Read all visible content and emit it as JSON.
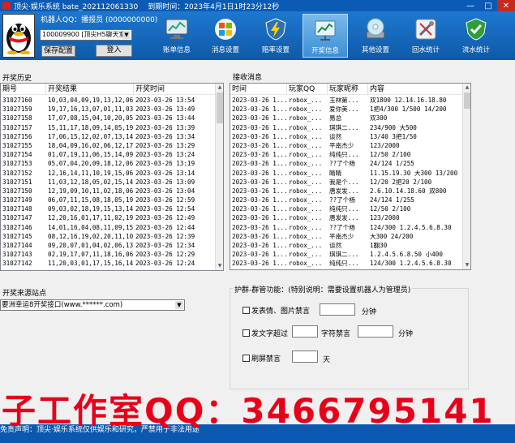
{
  "window": {
    "title": "顶尖·娱乐系统 bate_202112061330",
    "expire": "到期时间：2023年4月1日1时23分12秒",
    "min": "—",
    "max": "□",
    "close": "✕"
  },
  "header": {
    "robot_qq": "机器人QQ：播报员 (0000000000)",
    "robot_selected": "100009900 [顶尖H5聊天室]",
    "save_label": "保存配置",
    "login_label": "登入",
    "tabs": [
      {
        "label": "账单信息",
        "icon": "monitor-chart-icon"
      },
      {
        "label": "消息设置",
        "icon": "windows-logo-icon"
      },
      {
        "label": "赔率设置",
        "icon": "lightning-shield-icon"
      },
      {
        "label": "开奖信息",
        "icon": "screen-chart-icon"
      },
      {
        "label": "其他设置",
        "icon": "disc-drive-icon"
      },
      {
        "label": "回水统计",
        "icon": "tools-icon"
      },
      {
        "label": "流水统计",
        "icon": "green-shield-icon"
      }
    ]
  },
  "history": {
    "title": "开奖历史",
    "columns": [
      "期号",
      "开奖结果",
      "开奖时间"
    ],
    "rows": [
      [
        "31027160",
        "10,03,04,09,19,13,12,06",
        "2023-03-26 13:54"
      ],
      [
        "31027159",
        "19,17,16,13,07,01,11,03",
        "2023-03-26 13:49"
      ],
      [
        "31027158",
        "17,07,08,15,04,10,20,05",
        "2023-03-26 13:44"
      ],
      [
        "31027157",
        "15,11,17,18,09,14,05,19",
        "2023-03-26 13:39"
      ],
      [
        "31027156",
        "17,06,15,12,02,07,13,14",
        "2023-03-26 13:34"
      ],
      [
        "31027155",
        "18,04,09,16,02,06,12,17",
        "2023-03-26 13:29"
      ],
      [
        "31027154",
        "01,07,19,11,06,15,14,09",
        "2023-03-26 13:24"
      ],
      [
        "31027153",
        "05,07,04,20,09,18,12,06",
        "2023-03-26 13:19"
      ],
      [
        "31027152",
        "12,16,14,11,10,19,15,06",
        "2023-03-26 13:14"
      ],
      [
        "31027151",
        "11,03,12,18,05,02,15,14",
        "2023-03-26 13:09"
      ],
      [
        "31027150",
        "12,19,09,10,11,02,18,06",
        "2023-03-26 13:04"
      ],
      [
        "31027149",
        "06,07,11,15,08,18,05,19",
        "2023-03-26 12:59"
      ],
      [
        "31027148",
        "09,03,02,18,19,15,13,14",
        "2023-03-26 12:54"
      ],
      [
        "31027147",
        "12,20,16,01,17,11,02,19",
        "2023-03-26 12:49"
      ],
      [
        "31027146",
        "14,01,16,04,08,11,09,15",
        "2023-03-26 12:44"
      ],
      [
        "31027145",
        "08,12,16,19,02,20,11,10",
        "2023-03-26 12:39"
      ],
      [
        "31027144",
        "09,20,07,01,04,02,06,13",
        "2023-03-26 12:34"
      ],
      [
        "31027143",
        "02,19,17,07,11,18,16,06",
        "2023-03-26 12:29"
      ],
      [
        "31027142",
        "11,20,03,01,17,15,16,14",
        "2023-03-26 12:24"
      ]
    ]
  },
  "messages": {
    "title": "接收消息",
    "columns": [
      "时间",
      "玩家QQ",
      "玩家昵称",
      "内容"
    ],
    "rows": [
      [
        "2023-03-26 1...",
        "robox_...",
        "玉林第...",
        "双1800 12.14.16.18.80"
      ],
      [
        "2023-03-26 1...",
        "robox_...",
        "爱你美...",
        "1把4/300 1/500 14/200"
      ],
      [
        "2023-03-26 1...",
        "robox_...",
        "易总",
        "双300"
      ],
      [
        "2023-03-26 1...",
        "robox_...",
        "琪琪二...",
        "234/900 大500"
      ],
      [
        "2023-03-26 1...",
        "robox_...",
        "谈然",
        "13/40 3把1/50"
      ],
      [
        "2023-03-26 1...",
        "robox_...",
        "平南杰少",
        "123/2000"
      ],
      [
        "2023-03-26 1...",
        "robox_...",
        "纯纯只...",
        "12/50 2/100"
      ],
      [
        "2023-03-26 1...",
        "robox_...",
        "??了个杨",
        "24/124 1/255"
      ],
      [
        "2023-03-26 1...",
        "robox_...",
        "睛睛",
        "11.15.19.30 大300 13/200"
      ],
      [
        "2023-03-26 1...",
        "robox_...",
        "我是个...",
        "12/20 2把20 2/100"
      ],
      [
        "2023-03-26 1...",
        "robox_...",
        "唐发发...",
        "2.6.10.14.18.60 双800"
      ],
      [
        "2023-03-26 1...",
        "robox_...",
        "??了个杨",
        "24/124 1/255"
      ],
      [
        "2023-03-26 1...",
        "robox_...",
        "纯纯只...",
        "12/50 2/100"
      ],
      [
        "2023-03-26 1...",
        "robox_...",
        "唐发发...",
        "123/2000"
      ],
      [
        "2023-03-26 1...",
        "robox_...",
        "??了个杨",
        "124/300 1.2.4.5.6.8.30"
      ],
      [
        "2023-03-26 1...",
        "robox_...",
        "平南杰少",
        "大300 24/200"
      ],
      [
        "2023-03-26 1...",
        "robox_...",
        "谈然",
        "1翻30"
      ],
      [
        "2023-03-26 1...",
        "robox_...",
        "琪琪二...",
        "1.2.4.5.6.8.50 小400"
      ],
      [
        "2023-03-26 1...",
        "robox_...",
        "纯纯只...",
        "124/300 1.2.4.5.6.8.30"
      ]
    ]
  },
  "source": {
    "title": "开奖来源站点",
    "selected": "要洲幸运8开奖接口(www.******.com)"
  },
  "guard": {
    "legend": "护群-群管功能：(特别说明：需要设置机器人为管理员)",
    "opt1_label": "发表情、图片禁言",
    "opt1_unit": "分钟",
    "opt2_label": "发文字超过",
    "opt2_mid": "字符禁言",
    "opt2_unit": "分钟",
    "opt3_label": "刷屏禁言",
    "opt3_unit": "天"
  },
  "watermark": "子工作室QQ：3466795141",
  "statusbar": "免责声明：顶尖·娱乐系统仅供娱乐和研究，严禁用于非法用途"
}
